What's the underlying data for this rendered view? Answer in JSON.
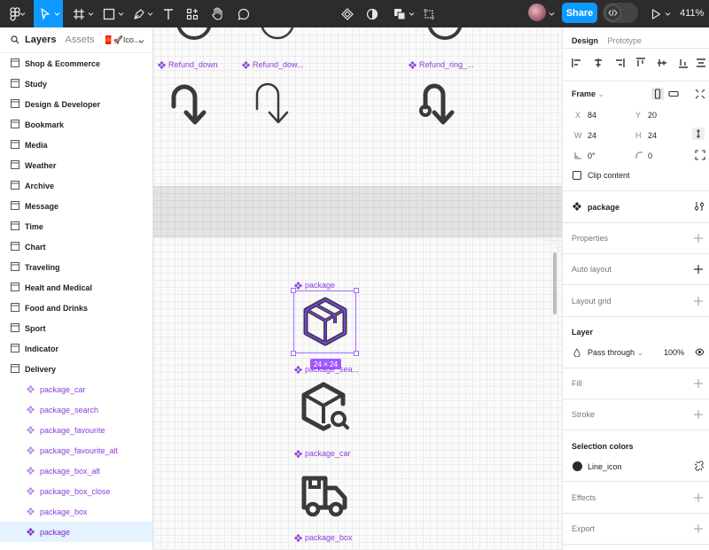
{
  "toolbar": {
    "share_label": "Share",
    "zoom_label": "411%",
    "brand_color": "#0d99ff",
    "bg_color": "#2c2c2c"
  },
  "left_panel": {
    "tabs": {
      "layers": "Layers",
      "assets": "Assets",
      "page": "🧧🚀Ico..."
    },
    "frames": [
      "Shop & Ecommerce",
      "Study",
      "Design & Developer",
      "Bookmark",
      "Media",
      "Weather",
      "Archive",
      "Message",
      "Time",
      "Chart",
      "Traveling",
      "Healt and Medical",
      "Food and Drinks",
      "Sport",
      "Indicator",
      "Delivery"
    ],
    "components": [
      "package_car",
      "package_search",
      "package_favourite",
      "package_favourite_alt",
      "package_box_alt",
      "package_box_close",
      "package_box",
      "package"
    ],
    "selected": "package"
  },
  "canvas": {
    "top_labels": [
      "Refund_down",
      "Refund_dow...",
      "Refund_ring_..."
    ],
    "selected_label": "package",
    "dim_badge": "24 × 24",
    "label_search": "package_sea...",
    "label_car": "package_car",
    "label_box": "package_box",
    "selection_color": "#a259ff",
    "icon_color": "#3a3a3e",
    "accent_icon_color": "#7b3fe4"
  },
  "right_panel": {
    "tabs": {
      "design": "Design",
      "prototype": "Prototype"
    },
    "frame_label": "Frame",
    "x_label": "X",
    "x_value": "84",
    "y_label": "Y",
    "y_value": "20",
    "w_label": "W",
    "w_value": "24",
    "h_label": "H",
    "h_value": "24",
    "rotation_value": "0°",
    "radius_value": "0",
    "clip_label": "Clip content",
    "component_name": "package",
    "sections": {
      "properties": "Properties",
      "auto_layout": "Auto layout",
      "layout_grid": "Layout grid",
      "layer": "Layer",
      "fill": "Fill",
      "stroke": "Stroke",
      "selection_colors": "Selection colors",
      "effects": "Effects",
      "export": "Export"
    },
    "blend_mode": "Pass through",
    "opacity": "100%",
    "selection_color_name": "Line_icon"
  }
}
